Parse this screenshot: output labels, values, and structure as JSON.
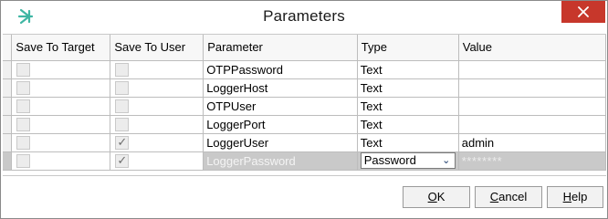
{
  "window": {
    "title": "Parameters",
    "icon": "star-burst-icon",
    "accent_color": "#3fb6a3",
    "close_color": "#c7372b"
  },
  "grid": {
    "columns": {
      "save_to_target": "Save To Target",
      "save_to_user": "Save To User",
      "parameter": "Parameter",
      "type": "Type",
      "value": "Value"
    },
    "rows": [
      {
        "save_to_target": false,
        "save_to_user": false,
        "parameter": "OTPPassword",
        "type": "Text",
        "value": ""
      },
      {
        "save_to_target": false,
        "save_to_user": false,
        "parameter": "LoggerHost",
        "type": "Text",
        "value": ""
      },
      {
        "save_to_target": false,
        "save_to_user": false,
        "parameter": "OTPUser",
        "type": "Text",
        "value": ""
      },
      {
        "save_to_target": false,
        "save_to_user": false,
        "parameter": "LoggerPort",
        "type": "Text",
        "value": ""
      },
      {
        "save_to_target": false,
        "save_to_user": true,
        "parameter": "LoggerUser",
        "type": "Text",
        "value": "admin"
      },
      {
        "save_to_target": false,
        "save_to_user": true,
        "parameter": "LoggerPassword",
        "type": "Password",
        "value": "********",
        "selected": true
      }
    ]
  },
  "buttons": {
    "ok_mnemonic": "O",
    "ok_rest": "K",
    "cancel_mnemonic": "C",
    "cancel_rest": "ancel",
    "help_mnemonic": "H",
    "help_rest": "elp"
  }
}
